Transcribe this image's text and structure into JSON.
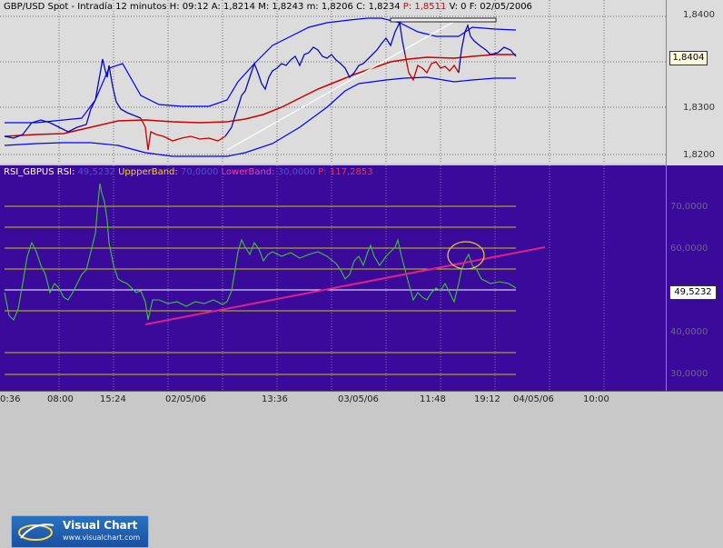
{
  "title_bar": {
    "symbol": "GBP/USD Spot - Intradía 12 minutos",
    "h_label": "H:",
    "h_value": "09:12",
    "a_label": "A:",
    "a_value": "1,8214",
    "m_label": "M:",
    "m_value": "1,8243",
    "min_label": "m:",
    "min_value": "1,8206",
    "c_label": "C:",
    "c_value": "1,8234",
    "p_label": "P:",
    "p_value": "1,8511",
    "v_label": "V:",
    "v_value": "0",
    "f_label": "F:",
    "f_value": "02/05/2006"
  },
  "price_axis": {
    "ticks": [
      "1,8400",
      "1,8300",
      "1,8200"
    ],
    "current": "1,8404"
  },
  "rsi_header": {
    "indicator": "RSI_GBPUS",
    "rsi_label": "RSI:",
    "rsi_value": "49,5232",
    "upper_label": "UppperBand:",
    "upper_value": "70,0000",
    "lower_label": "LowerBand:",
    "lower_value": "30,0000",
    "p_label": "P:",
    "p_value": "117,2853"
  },
  "rsi_axis": {
    "ticks": [
      "70,0000",
      "60,0000",
      "40,0000",
      "30,0000"
    ],
    "current": "49,5232"
  },
  "time_axis": {
    "labels": [
      "0:36",
      "08:00",
      "15:24",
      "02/05/06",
      "13:36",
      "03/05/06",
      "11:48",
      "19:12",
      "04/05/06",
      "10:00"
    ]
  },
  "logo": {
    "name": "Visual Chart",
    "url": "www.visualchart.com"
  },
  "colors": {
    "price_up": "#0a0ab4",
    "price_down": "#c80000",
    "ma": "#c80000",
    "band": "#0000ff",
    "trendline_top": "#ffffff",
    "rsi_line": "#3ec43e",
    "rsi_trend": "#e0208a",
    "level_yellow": "#c8c800",
    "rsi_bg": "#3a0a9a"
  }
}
